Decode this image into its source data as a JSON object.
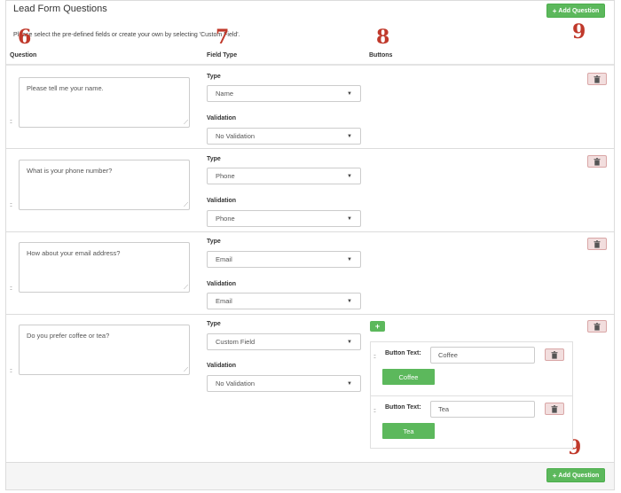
{
  "header": {
    "title": "Lead Form Questions",
    "add_question_label": "Add Question",
    "instructions": "Please select the pre-defined fields or create your own by selecting 'Custom Field'."
  },
  "annotations": {
    "a6": "6",
    "a7": "7",
    "a8": "8",
    "a9_top": "9",
    "a9_bottom": "9"
  },
  "columns": {
    "question": "Question",
    "field_type": "Field Type",
    "buttons": "Buttons"
  },
  "labels": {
    "type": "Type",
    "validation": "Validation",
    "button_text": "Button Text:"
  },
  "questions": [
    {
      "text": "Please tell me your name.",
      "type": "Name",
      "validation": "No Validation"
    },
    {
      "text": "What is your phone number?",
      "type": "Phone",
      "validation": "Phone"
    },
    {
      "text": "How about your email address?",
      "type": "Email",
      "validation": "Email"
    },
    {
      "text": "Do you prefer coffee or tea?",
      "type": "Custom Field",
      "validation": "No Validation",
      "buttons": [
        {
          "text": "Coffee",
          "preview": "Coffee"
        },
        {
          "text": "Tea",
          "preview": "Tea"
        }
      ]
    }
  ],
  "footer": {
    "add_question_label": "Add Question"
  },
  "colors": {
    "success": "#5cb85c",
    "danger_bg": "#f2dede",
    "annotation": "#c0392b"
  },
  "icons": {
    "add": "plus-icon",
    "delete": "trash-icon",
    "caret": "chevron-down-icon",
    "drag": "drag-handle-icon"
  }
}
